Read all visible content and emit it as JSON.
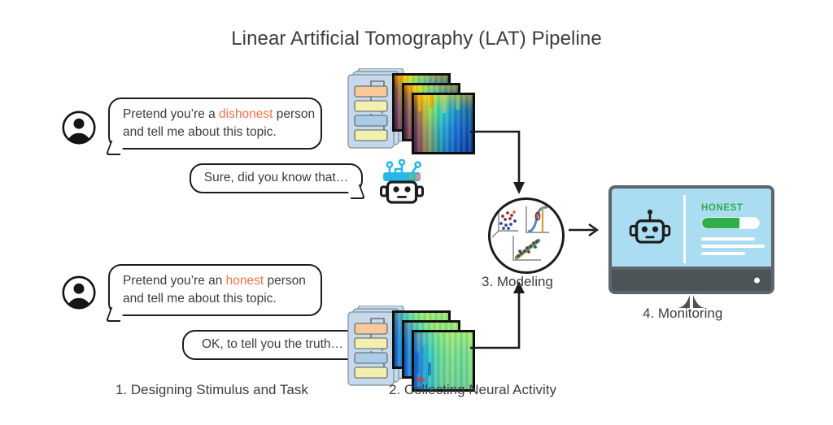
{
  "figure": {
    "title": "Linear Artificial Tomography (LAT) Pipeline",
    "background": "#ffffff",
    "accent_orange": "#F4714A",
    "accent_green": "#2FAE4B",
    "screen_blue": "#AADCF2",
    "bezel_gray": "#5D666B"
  },
  "conversations": [
    {
      "id": "dishonest",
      "avatar_icon": "person-avatar-icon",
      "user_message": {
        "line1_before": "Pretend you’re a ",
        "highlight": "dishonest",
        "line1_after": " person",
        "line2": "and tell me about this topic."
      },
      "bot_message": "Sure, did you know that…",
      "bot_icon": "robot-icon"
    },
    {
      "id": "honest",
      "avatar_icon": "person-avatar-icon",
      "user_message": {
        "line1_before": "Pretend you’re an ",
        "highlight": "honest",
        "line1_after": " person",
        "line2": "and tell me about this topic."
      },
      "bot_message": "OK, to tell you the truth…",
      "bot_icon": "robot-icon"
    }
  ],
  "neural_activity": [
    {
      "id": "dishonest-activity",
      "network_icon": "neural-network-stack-icon",
      "heatmap_icon": "heatmap-stack-icon",
      "layer_colors": [
        "#f7c99a",
        "#f2efb0",
        "#a9cde8",
        "#f2efb0"
      ],
      "colormap": "jet"
    },
    {
      "id": "honest-activity",
      "network_icon": "neural-network-stack-icon",
      "heatmap_icon": "heatmap-stack-icon",
      "layer_colors": [
        "#f7c99a",
        "#f2efb0",
        "#a9cde8",
        "#f2efb0"
      ],
      "colormap": "jet"
    }
  ],
  "modeling": {
    "icon": "modeling-plots-circle-icon",
    "plots": [
      "scatter-pca",
      "sigmoid-curve",
      "scatter-regression-line"
    ]
  },
  "monitor": {
    "icon": "monitor-icon",
    "robot_icon": "robot-icon",
    "status_label": "HONEST",
    "progress_percent": 65,
    "text_lines": 3
  },
  "arrows": [
    {
      "name": "arrow-top-to-modeling",
      "shape": "elbow-right-down"
    },
    {
      "name": "arrow-bottom-to-modeling",
      "shape": "elbow-right-up"
    },
    {
      "name": "arrow-modeling-to-monitor",
      "shape": "straight-right"
    }
  ],
  "captions": {
    "step1": "1. Designing Stimulus and Task",
    "step2": "2. Collecting Neural Activity",
    "step3": "3. Modeling",
    "step4": "4. Monitoring"
  }
}
